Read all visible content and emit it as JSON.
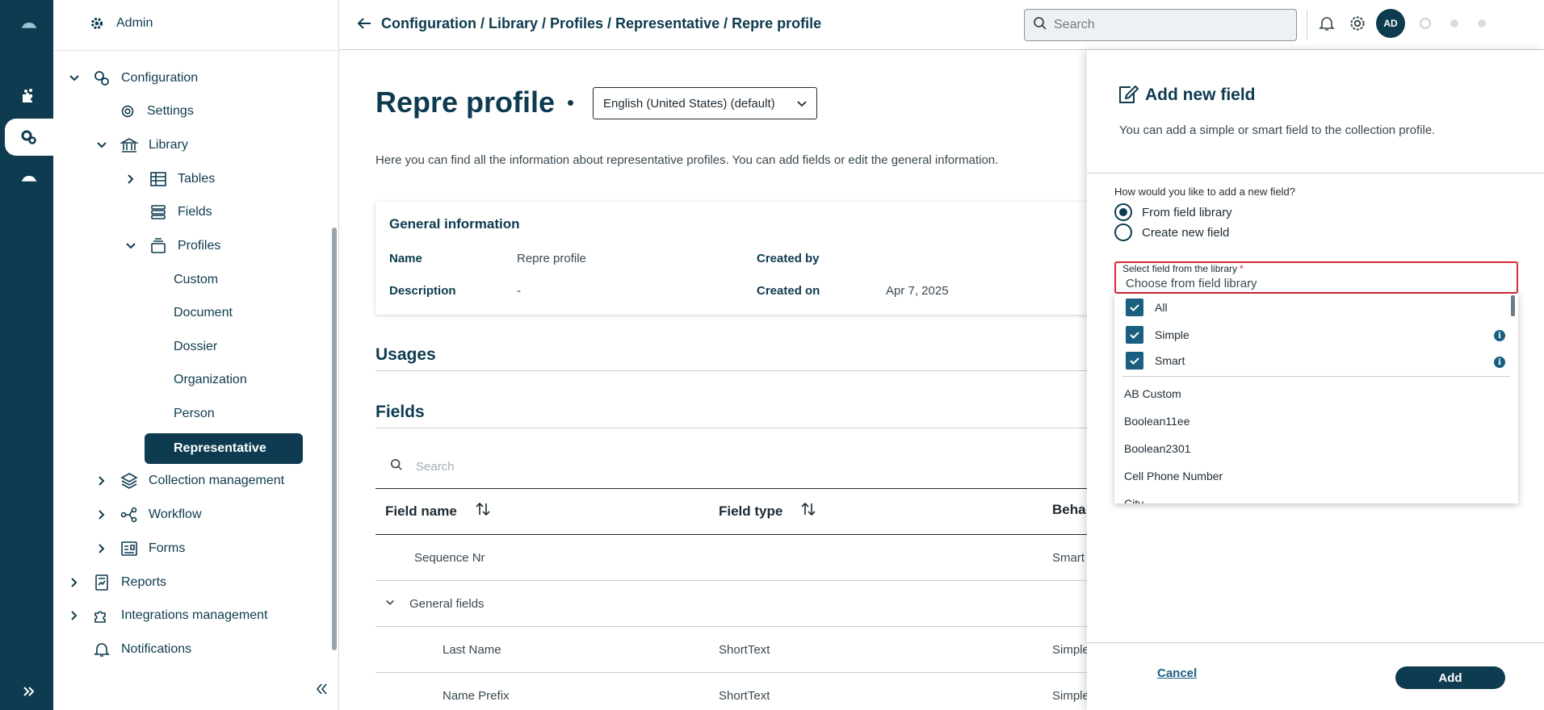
{
  "colors": {
    "brand": "#0e3b4f",
    "accent": "#1a5f80",
    "error": "#d4283b"
  },
  "rail": {
    "items": [
      "cloud-icon",
      "puzzle-icon",
      "gears-icon",
      "cloud-icon"
    ]
  },
  "nav": {
    "admin": "Admin",
    "configuration": "Configuration",
    "settings": "Settings",
    "library": "Library",
    "tables": "Tables",
    "fields": "Fields",
    "profiles": "Profiles",
    "custom": "Custom",
    "document": "Document",
    "dossier": "Dossier",
    "organization": "Organization",
    "person": "Person",
    "representative": "Representative",
    "collection_management": "Collection management",
    "workflow": "Workflow",
    "forms": "Forms",
    "reports": "Reports",
    "integrations_management": "Integrations management",
    "notifications": "Notifications"
  },
  "header": {
    "breadcrumb": "Configuration / Library / Profiles / Representative / Repre profile",
    "search_placeholder": "Search",
    "avatar": "AD"
  },
  "main": {
    "title": "Repre profile",
    "language": "English (United States) (default)",
    "intro": "Here you can find all the information about representative profiles. You can add fields or edit the general information.",
    "general": {
      "heading": "General information",
      "name_label": "Name",
      "name_value": "Repre profile",
      "description_label": "Description",
      "description_value": "-",
      "created_by_label": "Created by",
      "created_on_label": "Created on",
      "created_on_value": "Apr 7, 2025"
    },
    "usages_title": "Usages",
    "fields_title": "Fields",
    "fields_search_placeholder": "Search",
    "columns": {
      "field_name": "Field name",
      "field_type": "Field type",
      "behavior": "Beha"
    },
    "rows": [
      {
        "name": "Sequence Nr",
        "type": "",
        "behavior": "Smart"
      },
      {
        "name": "General fields",
        "type": "",
        "behavior": ""
      },
      {
        "name": "Last Name",
        "type": "ShortText",
        "behavior": "Simple"
      },
      {
        "name": "Name Prefix",
        "type": "ShortText",
        "behavior": "Simple"
      }
    ]
  },
  "panel": {
    "title": "Add new field",
    "subtitle": "You can add a simple or smart field to the collection profile.",
    "question": "How would you like to add a new field?",
    "radio_library": "From field library",
    "radio_new": "Create new field",
    "select_label": "Select field from the library",
    "select_required": "*",
    "select_placeholder": "Choose from field library",
    "checks": [
      "All",
      "Simple",
      "Smart"
    ],
    "options": [
      "AB Custom",
      "Boolean11ee",
      "Boolean2301",
      "Cell Phone Number",
      "City"
    ],
    "cancel": "Cancel",
    "add": "Add"
  }
}
